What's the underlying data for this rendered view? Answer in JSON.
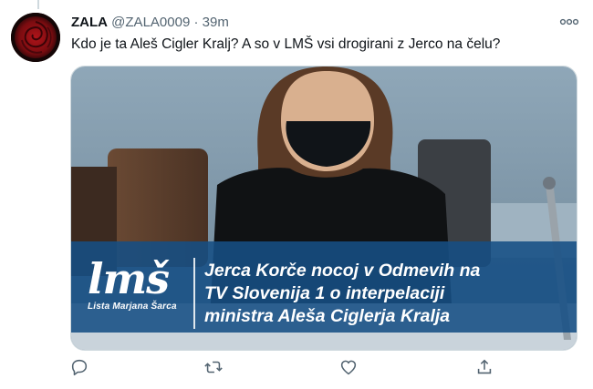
{
  "tweet": {
    "display_name": "ZALA",
    "handle": "@ZALA0009",
    "separator": "·",
    "time": "39m",
    "text": "Kdo je ta Aleš Cigler Kralj? A so v LMŠ vsi drogirani z Jerco na čelu?"
  },
  "media": {
    "brand_mark": "lmš",
    "brand_subtitle": "Lista Marjana Šarca",
    "headline_lines": [
      "Jerca Korče nocoj v Odmevih na",
      "TV Slovenija 1 o interpelaciji",
      "ministra Aleša Ciglerja Kralja"
    ]
  },
  "icons": {
    "more": "more-options-icon",
    "reply": "reply-icon",
    "retweet": "retweet-icon",
    "like": "like-icon",
    "share": "share-icon"
  },
  "colors": {
    "banner": "#164e84",
    "muted_text": "#536471",
    "icon": "#536471"
  }
}
